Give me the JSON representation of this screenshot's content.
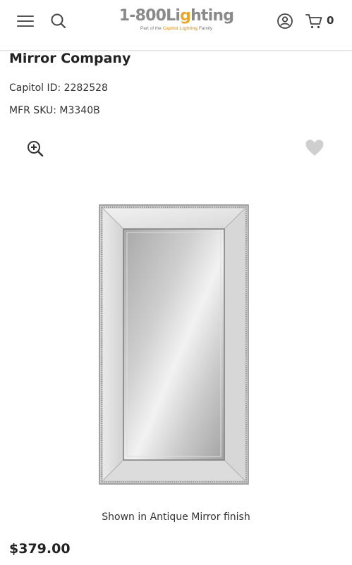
{
  "header": {
    "logo_main_prefix": "1-800Li",
    "logo_main_bulb": "g",
    "logo_main_suffix": "hting",
    "logo_tag_pre": "Part of the ",
    "logo_tag_brand": "Capitol Lighting",
    "logo_tag_post": " Family",
    "cart_count": "0",
    "icons": [
      "menu-icon",
      "search-icon",
      "account-icon",
      "cart-icon"
    ]
  },
  "product": {
    "brand": "Mirror Company",
    "capitol_id_line": "Capitol ID: 2282528",
    "mfr_sku_line": "MFR SKU: M3340B",
    "image_caption": "Shown in Antique Mirror finish",
    "price": "$379.00",
    "icons": [
      "zoom-in-icon",
      "heart-icon"
    ]
  },
  "colors": {
    "logo_gray": "#8a8a8a",
    "logo_accent": "#e7a92b",
    "favorite_heart": "#cfcfcf",
    "text": "#222222"
  }
}
